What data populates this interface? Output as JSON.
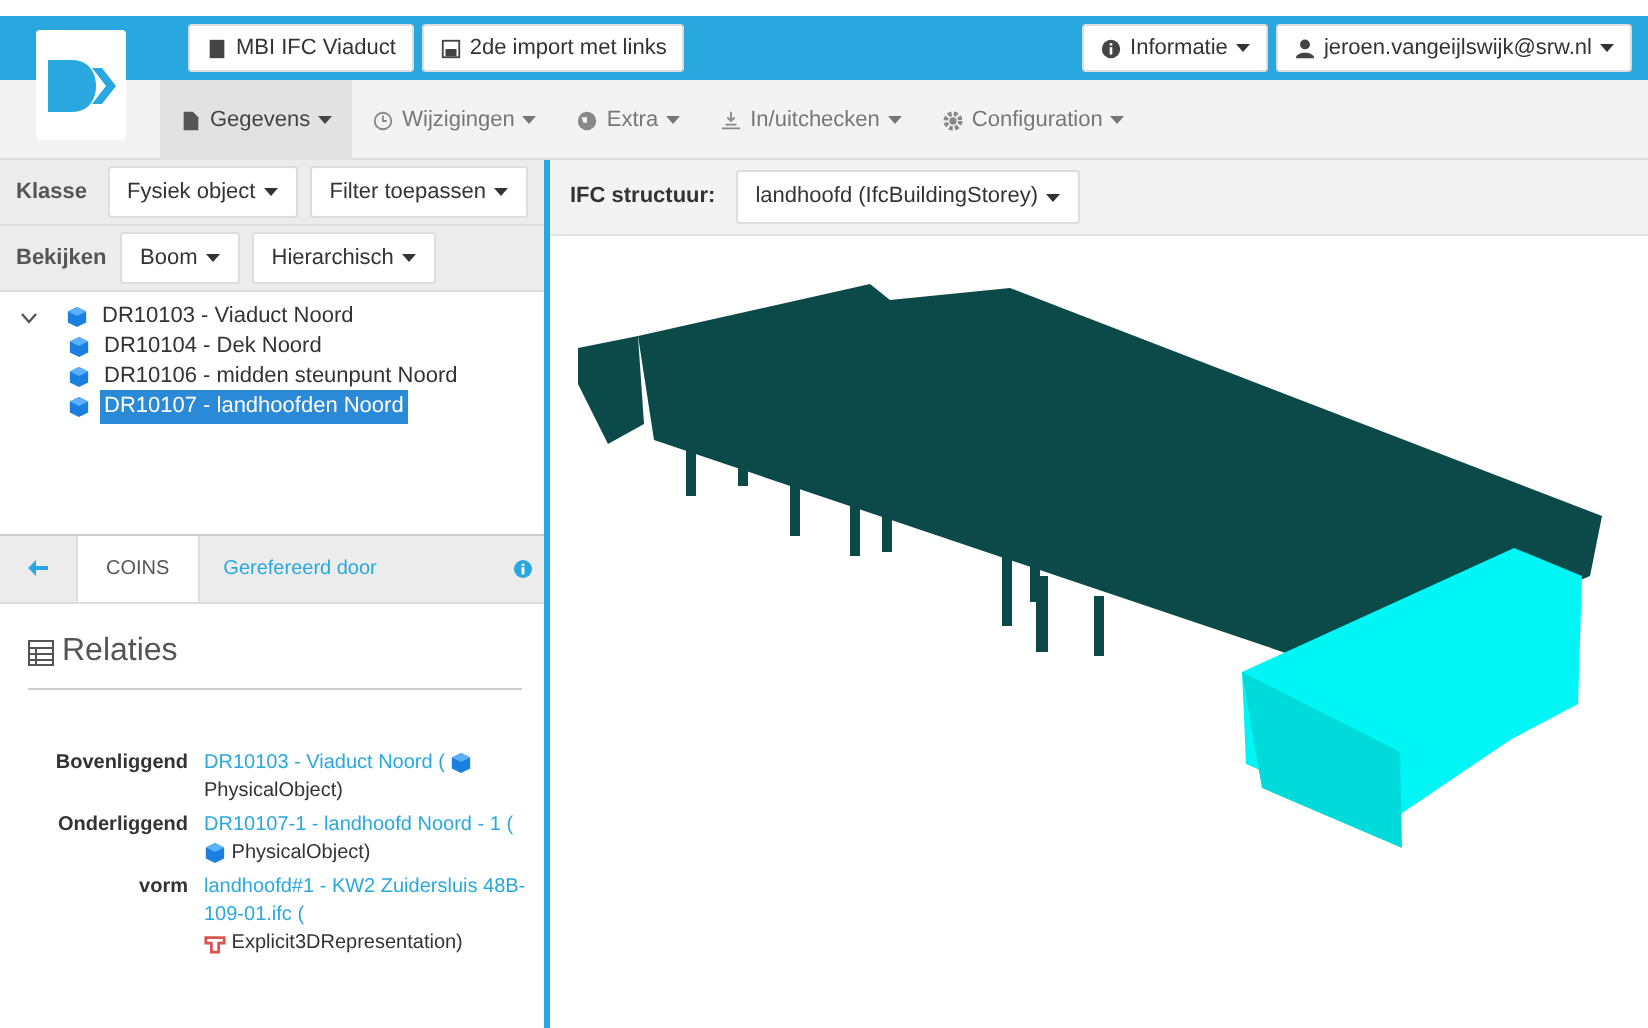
{
  "header": {
    "project_buttons": [
      {
        "label": "MBI IFC Viaduct"
      },
      {
        "label": "2de import met links"
      }
    ],
    "right_buttons": [
      {
        "label": "Informatie"
      },
      {
        "label": "jeroen.vangeijlswijk@srw.nl"
      }
    ]
  },
  "menu": [
    {
      "label": "Gegevens",
      "selected": true
    },
    {
      "label": "Wijzigingen",
      "selected": false
    },
    {
      "label": "Extra",
      "selected": false
    },
    {
      "label": "In/uitchecken",
      "selected": false
    },
    {
      "label": "Configuration",
      "selected": false
    }
  ],
  "filters": [
    {
      "label": "Klasse",
      "buttons": [
        "Fysiek object",
        "Filter toepassen"
      ]
    },
    {
      "label": "Bekijken",
      "buttons": [
        "Boom",
        "Hierarchisch"
      ]
    }
  ],
  "tree": [
    {
      "label": "DR10103 - Viaduct Noord",
      "expanded": true,
      "selected": false,
      "children": [
        {
          "label": "DR10104 - Dek Noord",
          "selected": false
        },
        {
          "label": "DR10106 - midden steunpunt Noord",
          "selected": false
        },
        {
          "label": "DR10107 - landhoofden Noord",
          "selected": true
        }
      ]
    }
  ],
  "detail_tabs": [
    {
      "label": "COINS",
      "selected": true
    },
    {
      "label": "Gerefereerd door",
      "selected": false
    }
  ],
  "relations_title": "Relaties",
  "relations": [
    {
      "label": "Bovenliggend",
      "link": "DR10103 - Viaduct Noord (",
      "kind": "physical",
      "type": "PhysicalObject)"
    },
    {
      "label": "Onderliggend",
      "link": "DR10107-1 - landhoofd Noord - 1 (",
      "kind": "physical",
      "type": "PhysicalObject)"
    },
    {
      "label": "vorm",
      "link": "landhoofd#1 - KW2 Zuidersluis 48B-109-01.ifc (",
      "kind": "representation",
      "type": "Explicit3DRepresentation)"
    }
  ],
  "ifc": {
    "label": "IFC structuur:",
    "value": "landhoofd (IfcBuildingStorey)"
  }
}
